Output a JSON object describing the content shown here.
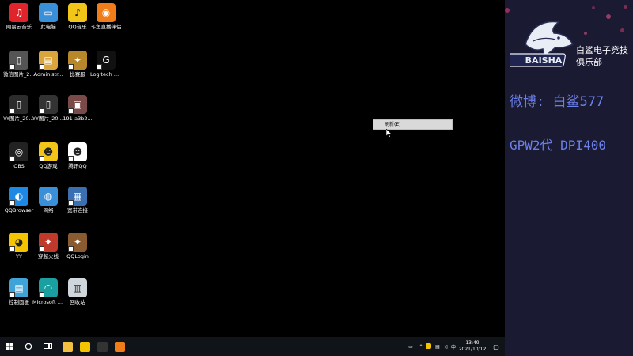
{
  "desktop": {
    "icons": [
      {
        "label": "网易云音乐",
        "color": "#e0242b",
        "glyph": "♫"
      },
      {
        "label": "此电脑",
        "color": "#3a8fd9",
        "glyph": "▭"
      },
      {
        "label": "QQ音乐",
        "color": "#f2c618",
        "glyph": "♪"
      },
      {
        "label": "斗鱼直播伴侣",
        "color": "#f07c1a",
        "glyph": "◉"
      },
      {
        "label": "微信图片_2020121...",
        "color": "#555555",
        "glyph": "▯"
      },
      {
        "label": "Administr...",
        "color": "#d9a53c",
        "glyph": "▤"
      },
      {
        "label": "比赛服",
        "color": "#b8862b",
        "glyph": "✦"
      },
      {
        "label": "Logitech G HUB",
        "color": "#111111",
        "glyph": "G"
      },
      {
        "label": "YY图片_20210123...",
        "color": "#2c2c2c",
        "glyph": "▯"
      },
      {
        "label": "YY图片_20210630...",
        "color": "#333333",
        "glyph": "▯"
      },
      {
        "label": "191-a3b2...",
        "color": "#7a4a48",
        "glyph": "▣"
      },
      {
        "label": "OBS",
        "color": "#222222",
        "glyph": "◎"
      },
      {
        "label": "QQ游戏",
        "color": "#f2c618",
        "glyph": "☻"
      },
      {
        "label": "腾讯QQ",
        "color": "#ffffff",
        "glyph": "☻"
      },
      {
        "label": "QQBrowser",
        "color": "#1e88e5",
        "glyph": "◐"
      },
      {
        "label": "网络",
        "color": "#3a8fd9",
        "glyph": "◍"
      },
      {
        "label": "宽带连接",
        "color": "#3a6fb0",
        "glyph": "▦"
      },
      {
        "label": "YY",
        "color": "#f5c400",
        "glyph": "◕"
      },
      {
        "label": "穿越火线",
        "color": "#c0392b",
        "glyph": "✦"
      },
      {
        "label": "QQLogin",
        "color": "#8a5a30",
        "glyph": "✦"
      },
      {
        "label": "控制面板",
        "color": "#3fa3d8",
        "glyph": "▤"
      },
      {
        "label": "Microsoft Edge",
        "color": "#1aa0a0",
        "glyph": "◠"
      },
      {
        "label": "回收站",
        "color": "#cfd6dc",
        "glyph": "▥"
      }
    ]
  },
  "context_menu": {
    "item": "刷新(E)"
  },
  "panel": {
    "club_name": "白鲨电子竞技俱乐部",
    "weibo": "微博: 白鲨577",
    "mouse_info": "GPW2代 DPI400",
    "logo_text": "BAISHA"
  },
  "taskbar": {
    "start": "start-icon",
    "search": "search-circle-icon",
    "task_view": "task-view-icon",
    "apps": [
      {
        "name": "file-explorer",
        "color": "#f2c041"
      },
      {
        "name": "yy",
        "color": "#f5c400"
      },
      {
        "name": "obs",
        "color": "#333333"
      },
      {
        "name": "douyu",
        "color": "#f07c1a"
      }
    ],
    "clock_time": "13:49",
    "clock_date": "2021/10/12"
  }
}
